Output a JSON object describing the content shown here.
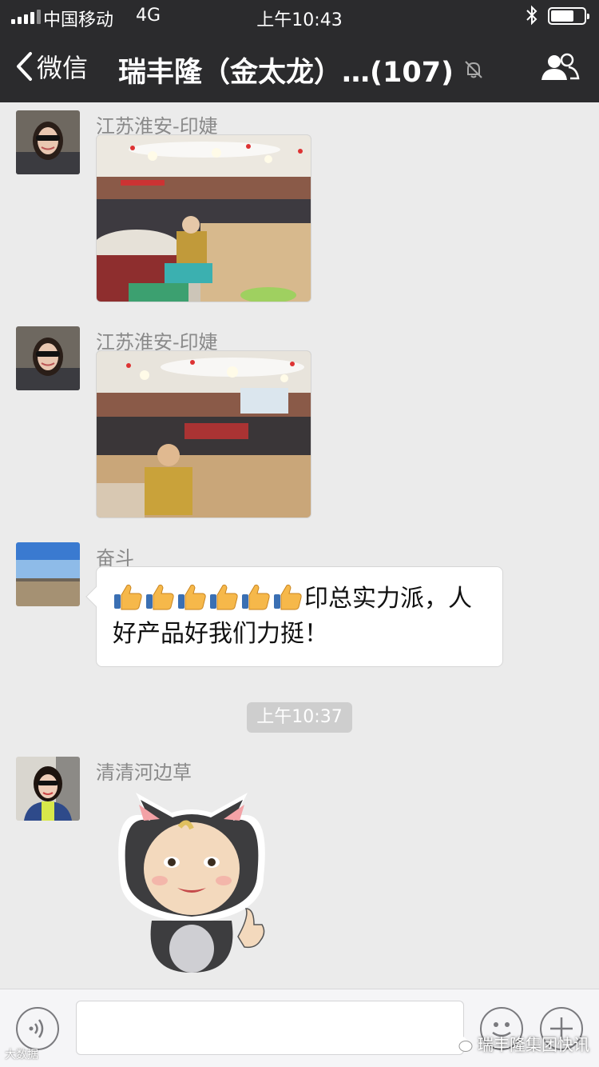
{
  "status_bar": {
    "carrier": "中国移动",
    "network": "4G",
    "time": "上午10:43"
  },
  "nav": {
    "back_label": "微信",
    "title": "瑞丰隆（金太龙）…(107)"
  },
  "messages": [
    {
      "sender": "江苏淮安-印婕",
      "type": "image"
    },
    {
      "sender": "江苏淮安-印婕",
      "type": "image"
    },
    {
      "sender": "奋斗",
      "type": "text",
      "text": "印总实力派，人好产品好我们力挺！",
      "emoji_count": 6
    },
    {
      "sender": "清清河边草",
      "type": "sticker"
    }
  ],
  "timestamp": "上午10:37",
  "watermark": {
    "left": "大数据",
    "right": "瑞丰隆集团快讯"
  },
  "colors": {
    "nav_bg": "#2b2b2d",
    "chat_bg": "#ebebeb",
    "bubble_bg": "#ffffff",
    "timestamp_bg": "#cecece"
  },
  "icons": [
    "signal-icon",
    "bluetooth-icon",
    "battery-icon",
    "back-chevron-icon",
    "mute-icon",
    "group-members-icon",
    "voice-icon",
    "emoji-icon",
    "plus-icon",
    "thumbs-up-icon"
  ]
}
